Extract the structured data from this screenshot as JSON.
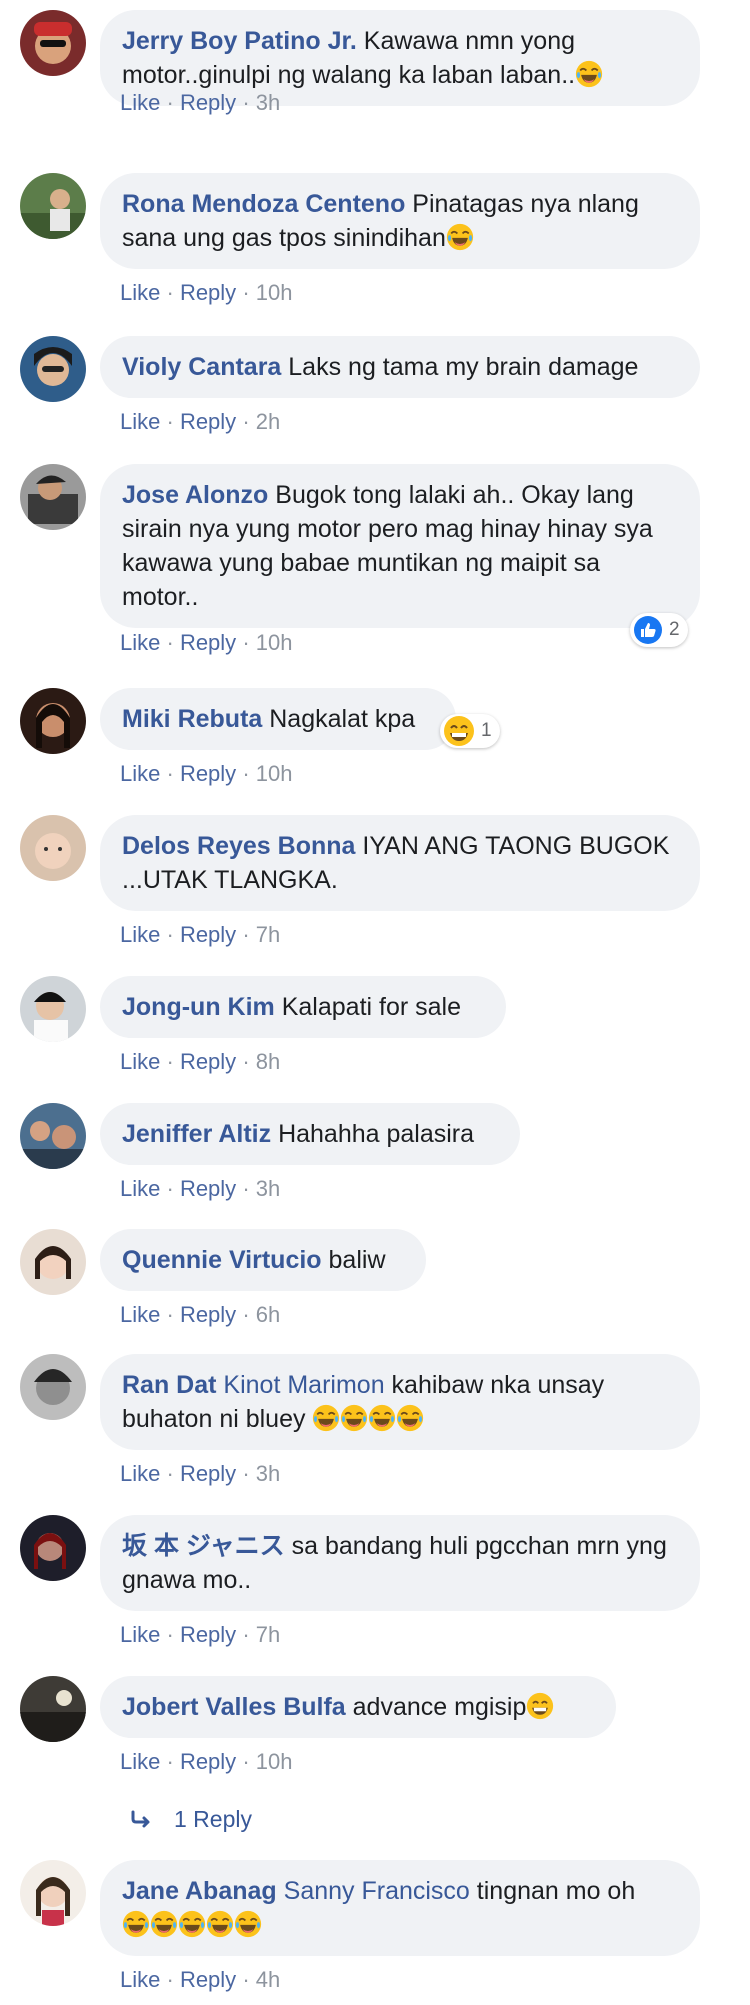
{
  "actions": {
    "like": "Like",
    "reply": "Reply",
    "sep": "·"
  },
  "colors": {
    "link": "#385898",
    "bubble": "#f0f2f5",
    "meta": "#8d949e",
    "like_blue": "#1877f2"
  },
  "comments": [
    {
      "author": "Jerry Boy Patino Jr.",
      "text": "Kawawa nmn yong motor..ginulpi ng walang ka laban laban..",
      "emoji": [
        "laughing-tears"
      ],
      "time": "3h"
    },
    {
      "author": "Rona Mendoza Centeno",
      "text": "Pinatagas nya nlang sana ung gas tpos sinindihan",
      "emoji": [
        "laughing-tears"
      ],
      "time": "10h"
    },
    {
      "author": "Violy Cantara",
      "text": "Laks ng tama my brain damage",
      "time": "2h"
    },
    {
      "author": "Jose Alonzo",
      "text": "Bugok tong lalaki ah.. Okay lang sirain nya yung motor pero mag hinay hinay sya kawawa yung babae muntikan ng maipit sa motor..",
      "time": "10h",
      "reaction": {
        "icon": "like-icon",
        "count": "2"
      }
    },
    {
      "author": "Miki Rebuta",
      "text": "Nagkalat kpa",
      "time": "10h",
      "reaction": {
        "icon": "laugh-icon",
        "count": "1"
      }
    },
    {
      "author": "Delos Reyes Bonna",
      "text": "IYAN ANG TAONG BUGOK ...UTAK TLANGKA.",
      "time": "7h"
    },
    {
      "author": "Jong-un Kim",
      "text": "Kalapati for sale",
      "time": "8h"
    },
    {
      "author": "Jeniffer Altiz",
      "text": "Hahahha palasira",
      "time": "3h"
    },
    {
      "author": "Quennie Virtucio",
      "text": "baliw",
      "time": "6h"
    },
    {
      "author": "Ran Dat",
      "mention": "Kinot Marimon",
      "text": "kahibaw nka unsay buhaton ni bluey",
      "emoji": [
        "laughing-tears",
        "laughing-tears",
        "laughing-tears",
        "laughing-tears"
      ],
      "time": "3h"
    },
    {
      "author": "坂 本 ジャニス",
      "text": "sa bandang huli pgcchan mrn yng gnawa mo..",
      "time": "7h"
    },
    {
      "author": "Jobert Valles Bulfa",
      "text": "advance mgisip",
      "emoji": [
        "grinning"
      ],
      "time": "10h",
      "replies": "1 Reply"
    },
    {
      "author": "Jane Abanag",
      "mention": "Sanny Francisco",
      "text": "tingnan mo oh",
      "emoji": [
        "laughing-tears",
        "laughing-tears",
        "laughing-tears",
        "laughing-tears",
        "laughing-tears"
      ],
      "time": "4h"
    }
  ]
}
